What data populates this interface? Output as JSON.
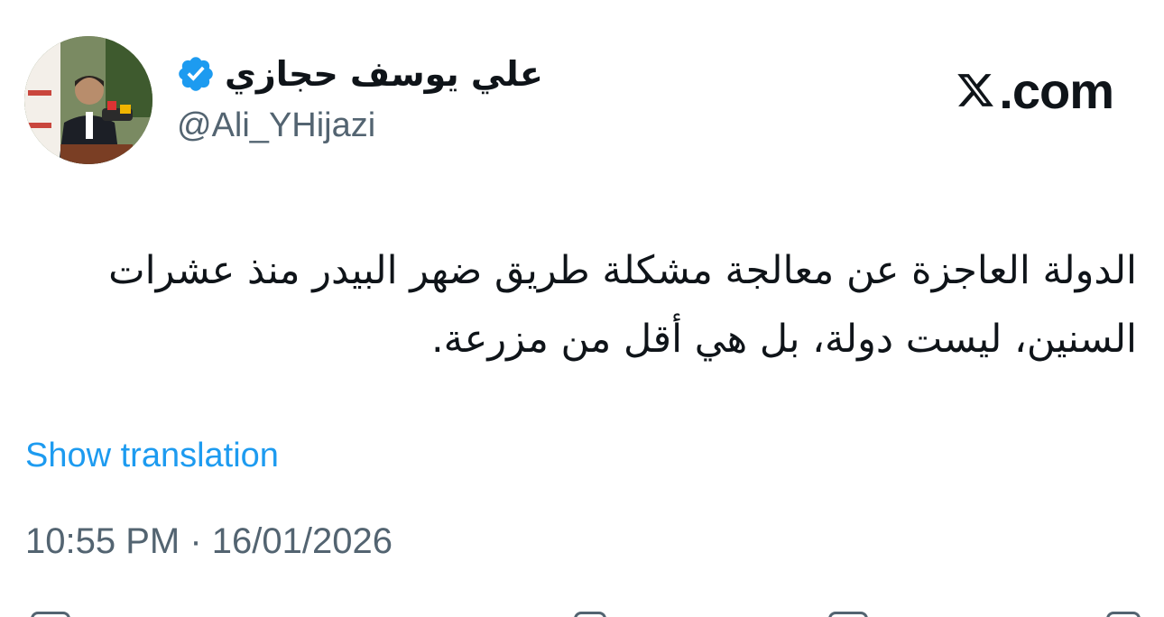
{
  "author": {
    "display_name": "علي يوسف حجازي",
    "handle": "@Ali_YHijazi",
    "verified": true,
    "verified_color": "#1d9bf0"
  },
  "brand": {
    "logo_icon": "x-logo-icon",
    "text": ".com"
  },
  "tweet": {
    "text": "الدولة العاجزة عن معالجة مشكلة طريق ضهر البيدر منذ عشرات السنين، ليست دولة، بل هي أقل من مزرعة.",
    "show_translation_label": "Show translation",
    "timestamp": "10:55 PM · 16/01/2026"
  },
  "colors": {
    "text": "#0f1419",
    "secondary": "#536471",
    "link": "#1d9bf0"
  }
}
